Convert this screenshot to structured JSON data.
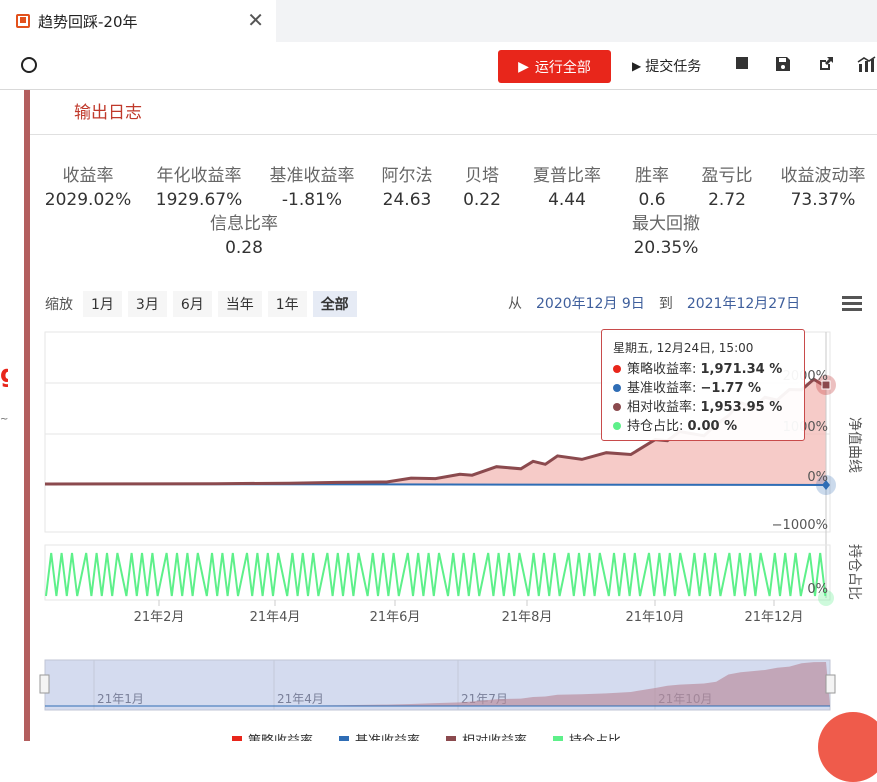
{
  "tab": {
    "title": "趋势回踩-20年",
    "close": "✕"
  },
  "toolbar": {
    "run_label": "运行全部",
    "submit_label": "提交任务"
  },
  "log": {
    "title": "输出日志"
  },
  "stats": [
    {
      "label": "收益率",
      "value": "2029.02%"
    },
    {
      "label": "年化收益率",
      "value": "1929.67%"
    },
    {
      "label": "基准收益率",
      "value": "-1.81%"
    },
    {
      "label": "阿尔法",
      "value": "24.63"
    },
    {
      "label": "贝塔",
      "value": "0.22"
    },
    {
      "label": "夏普比率",
      "value": "4.44"
    },
    {
      "label": "胜率",
      "value": "0.6"
    },
    {
      "label": "盈亏比",
      "value": "2.72"
    },
    {
      "label": "收益波动率",
      "value": "73.37%"
    },
    {
      "label": "信息比率",
      "value": "0.28"
    },
    {
      "label": "最大回撤",
      "value": "20.35%"
    }
  ],
  "range": {
    "label": "缩放",
    "buttons": [
      "1月",
      "3月",
      "6月",
      "当年",
      "1年",
      "全部"
    ],
    "active": "全部",
    "from_label": "从",
    "from": "2020年12月 9日",
    "to_label": "到",
    "to": "2021年12月27日"
  },
  "chart_data": {
    "type": "line",
    "y_axis_top": {
      "title": "净值曲线",
      "ticks": [
        "2000%",
        "1000%",
        "0%",
        "−1000%"
      ],
      "ylim": [
        -1000,
        2000
      ]
    },
    "y_axis_bottom": {
      "title": "持仓占比",
      "ticks": [
        "0%"
      ]
    },
    "x_ticks": [
      "21年2月",
      "21年4月",
      "21年6月",
      "21年8月",
      "21年10月",
      "21年12月"
    ],
    "navigator_ticks": [
      "21年1月",
      "21年4月",
      "21年7月",
      "21年10月"
    ],
    "series": [
      {
        "name": "策略收益率",
        "color": "#e8261b"
      },
      {
        "name": "基准收益率",
        "color": "#2f6db5"
      },
      {
        "name": "相对收益率",
        "color": "#8b4a4e",
        "points": [
          [
            0,
            0
          ],
          [
            40,
            2
          ],
          [
            70,
            5
          ],
          [
            100,
            15
          ],
          [
            120,
            30
          ],
          [
            140,
            60
          ],
          [
            150,
            90
          ],
          [
            160,
            130
          ],
          [
            170,
            160
          ],
          [
            175,
            200
          ],
          [
            185,
            300
          ],
          [
            195,
            330
          ],
          [
            200,
            400
          ],
          [
            205,
            420
          ],
          [
            210,
            500
          ],
          [
            220,
            520
          ],
          [
            230,
            560
          ],
          [
            240,
            620
          ],
          [
            250,
            800
          ],
          [
            255,
            900
          ],
          [
            260,
            950
          ],
          [
            270,
            1000
          ],
          [
            275,
            1080
          ],
          [
            280,
            1400
          ],
          [
            285,
            1500
          ],
          [
            290,
            1550
          ],
          [
            295,
            1600
          ],
          [
            300,
            1700
          ],
          [
            305,
            1750
          ],
          [
            310,
            1900
          ],
          [
            315,
            1950
          ],
          [
            320,
            1953.95
          ]
        ]
      },
      {
        "name": "持仓占比",
        "color": "#5ef08a"
      }
    ],
    "tooltip": {
      "title": "星期五, 12月24日, 15:00",
      "rows": [
        {
          "name": "策略收益率",
          "value": "1,971.34 %",
          "color": "#e8261b"
        },
        {
          "name": "基准收益率",
          "value": "−1.77 %",
          "color": "#2f6db5"
        },
        {
          "name": "相对收益率",
          "value": "1,953.95 %",
          "color": "#8b4a4e"
        },
        {
          "name": "持仓占比",
          "value": "0.00 %",
          "color": "#5ef08a"
        }
      ]
    }
  }
}
